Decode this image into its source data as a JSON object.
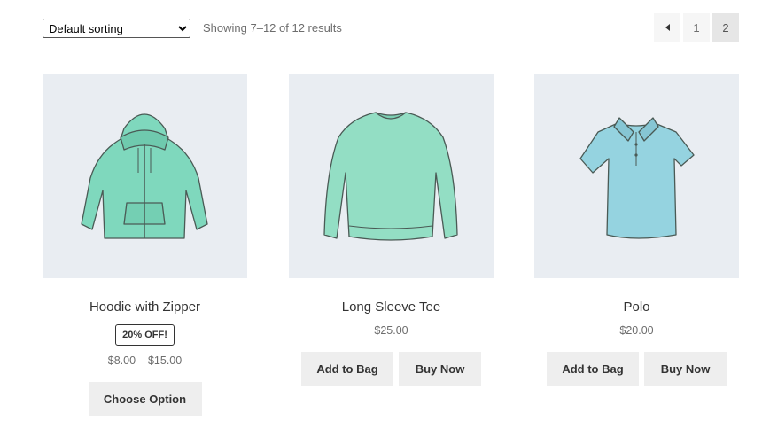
{
  "toolbar": {
    "sort_selected": "Default sorting",
    "result_count": "Showing 7–12 of 12 results"
  },
  "pagination": {
    "pages": [
      "1",
      "2"
    ],
    "current_page": "2"
  },
  "products": [
    {
      "title": "Hoodie with Zipper",
      "badge": "20% OFF!",
      "price": "$8.00 – $15.00",
      "primary_button": "Choose Option",
      "color": "#7fd8bd"
    },
    {
      "title": "Long Sleeve Tee",
      "price": "$25.00",
      "primary_button": "Add to Bag",
      "secondary_button": "Buy Now",
      "color": "#93dec4"
    },
    {
      "title": "Polo",
      "price": "$20.00",
      "primary_button": "Add to Bag",
      "secondary_button": "Buy Now",
      "color": "#95d3e0"
    }
  ]
}
